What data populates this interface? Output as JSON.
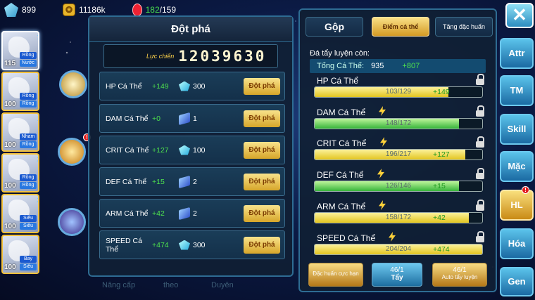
{
  "topbar": {
    "gems": "899",
    "gold": "11186k",
    "energy_current": "182",
    "energy_max": "/159"
  },
  "party": [
    {
      "level": "115",
      "tag1": "Rồng",
      "tag2": "Nước",
      "rank": "1",
      "selected": true
    },
    {
      "level": "100",
      "tag1": "Rồng",
      "tag2": "Rồng",
      "rank": "1"
    },
    {
      "level": "100",
      "tag1": "Nham",
      "tag2": "Rồng",
      "rank": "1"
    },
    {
      "level": "100",
      "tag1": "Rồng",
      "tag2": "Rồng",
      "rank": "2"
    },
    {
      "level": "100",
      "tag1": "Siêu",
      "tag2": "Siêu",
      "rank": "2"
    },
    {
      "level": "100",
      "tag1": "Bay",
      "tag2": "Siêu",
      "rank": ""
    }
  ],
  "breakthrough": {
    "title": "Đột phá",
    "power_label": "Lực chiến",
    "power_value": "12039630",
    "button_label": "Đột phá",
    "rows": [
      {
        "name": "HP Cá Thể",
        "inc": "+149",
        "cost": "300",
        "icon": "gem-icon"
      },
      {
        "name": "DAM Cá Thể",
        "inc": "+0",
        "cost": "1",
        "icon": "scroll-icon"
      },
      {
        "name": "CRIT Cá Thể",
        "inc": "+127",
        "cost": "100",
        "icon": "gem-icon"
      },
      {
        "name": "DEF Cá Thể",
        "inc": "+15",
        "cost": "2",
        "icon": "scroll-icon"
      },
      {
        "name": "ARM Cá Thể",
        "inc": "+42",
        "cost": "2",
        "icon": "scroll-icon"
      },
      {
        "name": "SPEED Cá Thể",
        "inc": "+474",
        "cost": "300",
        "icon": "gem-icon"
      }
    ]
  },
  "bottom_tabs": [
    "Nâng cấp",
    "theo",
    "Duyên"
  ],
  "detail": {
    "tabs": {
      "merge": "Gộp",
      "individual_points": "Điểm cá thể",
      "special_train": "Tăng đặc huấn"
    },
    "remaining_label": "Đá tẩy luyện còn:",
    "total_label": "Tổng Cá Thể:",
    "total_value": "935",
    "total_bonus": "+807",
    "stats": [
      {
        "name": "HP Cá Thể",
        "value": "103/129",
        "bonus": "+149",
        "fraction": 0.8,
        "color": "yellow",
        "bolt": false
      },
      {
        "name": "DAM Cá Thể",
        "value": "148/172",
        "bonus": "",
        "fraction": 0.86,
        "color": "green",
        "bolt": true
      },
      {
        "name": "CRIT Cá Thể",
        "value": "196/217",
        "bonus": "+127",
        "fraction": 0.9,
        "color": "yellow",
        "bolt": true
      },
      {
        "name": "DEF Cá Thể",
        "value": "126/146",
        "bonus": "+15",
        "fraction": 0.86,
        "color": "green",
        "bolt": true
      },
      {
        "name": "ARM Cá Thể",
        "value": "158/172",
        "bonus": "+42",
        "fraction": 0.92,
        "color": "yellow",
        "bolt": true
      },
      {
        "name": "SPEED Cá Thể",
        "value": "204/204",
        "bonus": "+474",
        "fraction": 1.0,
        "color": "yellow",
        "bolt": true
      }
    ],
    "buttons": {
      "special_training": "Đặc huấn cực hạn",
      "wash_count": "46/1",
      "wash_label": "Tẩy",
      "auto_count": "46/1",
      "auto_label": "Auto tẩy luyện"
    }
  },
  "nav": [
    "Attr",
    "TM",
    "Skill",
    "Mặc",
    "HL",
    "Hóa",
    "Gen"
  ],
  "nav_active": "HL"
}
